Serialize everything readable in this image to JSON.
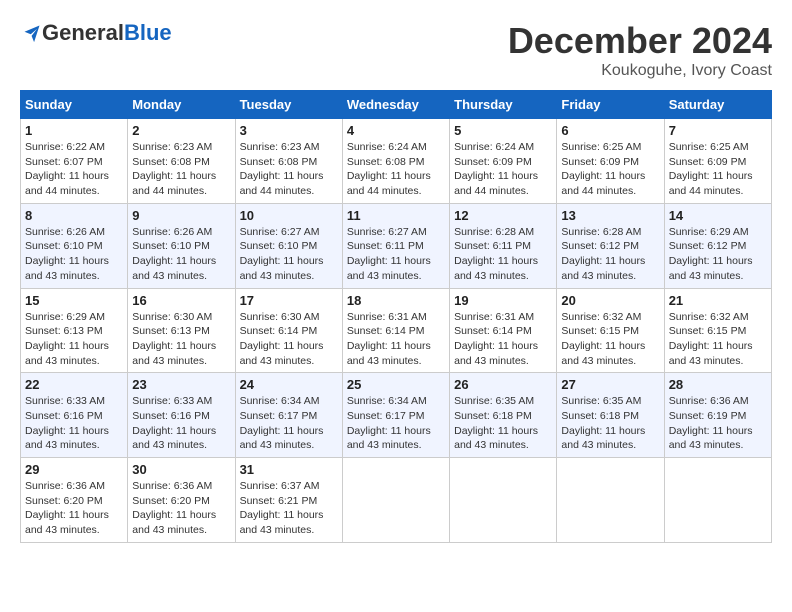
{
  "logo": {
    "general": "General",
    "blue": "Blue"
  },
  "title": "December 2024",
  "subtitle": "Koukoguhe, Ivory Coast",
  "days_header": [
    "Sunday",
    "Monday",
    "Tuesday",
    "Wednesday",
    "Thursday",
    "Friday",
    "Saturday"
  ],
  "weeks": [
    [
      {
        "day": "1",
        "sunrise": "6:22 AM",
        "sunset": "6:07 PM",
        "daylight": "11 hours and 44 minutes."
      },
      {
        "day": "2",
        "sunrise": "6:23 AM",
        "sunset": "6:08 PM",
        "daylight": "11 hours and 44 minutes."
      },
      {
        "day": "3",
        "sunrise": "6:23 AM",
        "sunset": "6:08 PM",
        "daylight": "11 hours and 44 minutes."
      },
      {
        "day": "4",
        "sunrise": "6:24 AM",
        "sunset": "6:08 PM",
        "daylight": "11 hours and 44 minutes."
      },
      {
        "day": "5",
        "sunrise": "6:24 AM",
        "sunset": "6:09 PM",
        "daylight": "11 hours and 44 minutes."
      },
      {
        "day": "6",
        "sunrise": "6:25 AM",
        "sunset": "6:09 PM",
        "daylight": "11 hours and 44 minutes."
      },
      {
        "day": "7",
        "sunrise": "6:25 AM",
        "sunset": "6:09 PM",
        "daylight": "11 hours and 44 minutes."
      }
    ],
    [
      {
        "day": "8",
        "sunrise": "6:26 AM",
        "sunset": "6:10 PM",
        "daylight": "11 hours and 43 minutes."
      },
      {
        "day": "9",
        "sunrise": "6:26 AM",
        "sunset": "6:10 PM",
        "daylight": "11 hours and 43 minutes."
      },
      {
        "day": "10",
        "sunrise": "6:27 AM",
        "sunset": "6:10 PM",
        "daylight": "11 hours and 43 minutes."
      },
      {
        "day": "11",
        "sunrise": "6:27 AM",
        "sunset": "6:11 PM",
        "daylight": "11 hours and 43 minutes."
      },
      {
        "day": "12",
        "sunrise": "6:28 AM",
        "sunset": "6:11 PM",
        "daylight": "11 hours and 43 minutes."
      },
      {
        "day": "13",
        "sunrise": "6:28 AM",
        "sunset": "6:12 PM",
        "daylight": "11 hours and 43 minutes."
      },
      {
        "day": "14",
        "sunrise": "6:29 AM",
        "sunset": "6:12 PM",
        "daylight": "11 hours and 43 minutes."
      }
    ],
    [
      {
        "day": "15",
        "sunrise": "6:29 AM",
        "sunset": "6:13 PM",
        "daylight": "11 hours and 43 minutes."
      },
      {
        "day": "16",
        "sunrise": "6:30 AM",
        "sunset": "6:13 PM",
        "daylight": "11 hours and 43 minutes."
      },
      {
        "day": "17",
        "sunrise": "6:30 AM",
        "sunset": "6:14 PM",
        "daylight": "11 hours and 43 minutes."
      },
      {
        "day": "18",
        "sunrise": "6:31 AM",
        "sunset": "6:14 PM",
        "daylight": "11 hours and 43 minutes."
      },
      {
        "day": "19",
        "sunrise": "6:31 AM",
        "sunset": "6:14 PM",
        "daylight": "11 hours and 43 minutes."
      },
      {
        "day": "20",
        "sunrise": "6:32 AM",
        "sunset": "6:15 PM",
        "daylight": "11 hours and 43 minutes."
      },
      {
        "day": "21",
        "sunrise": "6:32 AM",
        "sunset": "6:15 PM",
        "daylight": "11 hours and 43 minutes."
      }
    ],
    [
      {
        "day": "22",
        "sunrise": "6:33 AM",
        "sunset": "6:16 PM",
        "daylight": "11 hours and 43 minutes."
      },
      {
        "day": "23",
        "sunrise": "6:33 AM",
        "sunset": "6:16 PM",
        "daylight": "11 hours and 43 minutes."
      },
      {
        "day": "24",
        "sunrise": "6:34 AM",
        "sunset": "6:17 PM",
        "daylight": "11 hours and 43 minutes."
      },
      {
        "day": "25",
        "sunrise": "6:34 AM",
        "sunset": "6:17 PM",
        "daylight": "11 hours and 43 minutes."
      },
      {
        "day": "26",
        "sunrise": "6:35 AM",
        "sunset": "6:18 PM",
        "daylight": "11 hours and 43 minutes."
      },
      {
        "day": "27",
        "sunrise": "6:35 AM",
        "sunset": "6:18 PM",
        "daylight": "11 hours and 43 minutes."
      },
      {
        "day": "28",
        "sunrise": "6:36 AM",
        "sunset": "6:19 PM",
        "daylight": "11 hours and 43 minutes."
      }
    ],
    [
      {
        "day": "29",
        "sunrise": "6:36 AM",
        "sunset": "6:20 PM",
        "daylight": "11 hours and 43 minutes."
      },
      {
        "day": "30",
        "sunrise": "6:36 AM",
        "sunset": "6:20 PM",
        "daylight": "11 hours and 43 minutes."
      },
      {
        "day": "31",
        "sunrise": "6:37 AM",
        "sunset": "6:21 PM",
        "daylight": "11 hours and 43 minutes."
      },
      null,
      null,
      null,
      null
    ]
  ],
  "labels": {
    "sunrise": "Sunrise:",
    "sunset": "Sunset:",
    "daylight": "Daylight:"
  }
}
